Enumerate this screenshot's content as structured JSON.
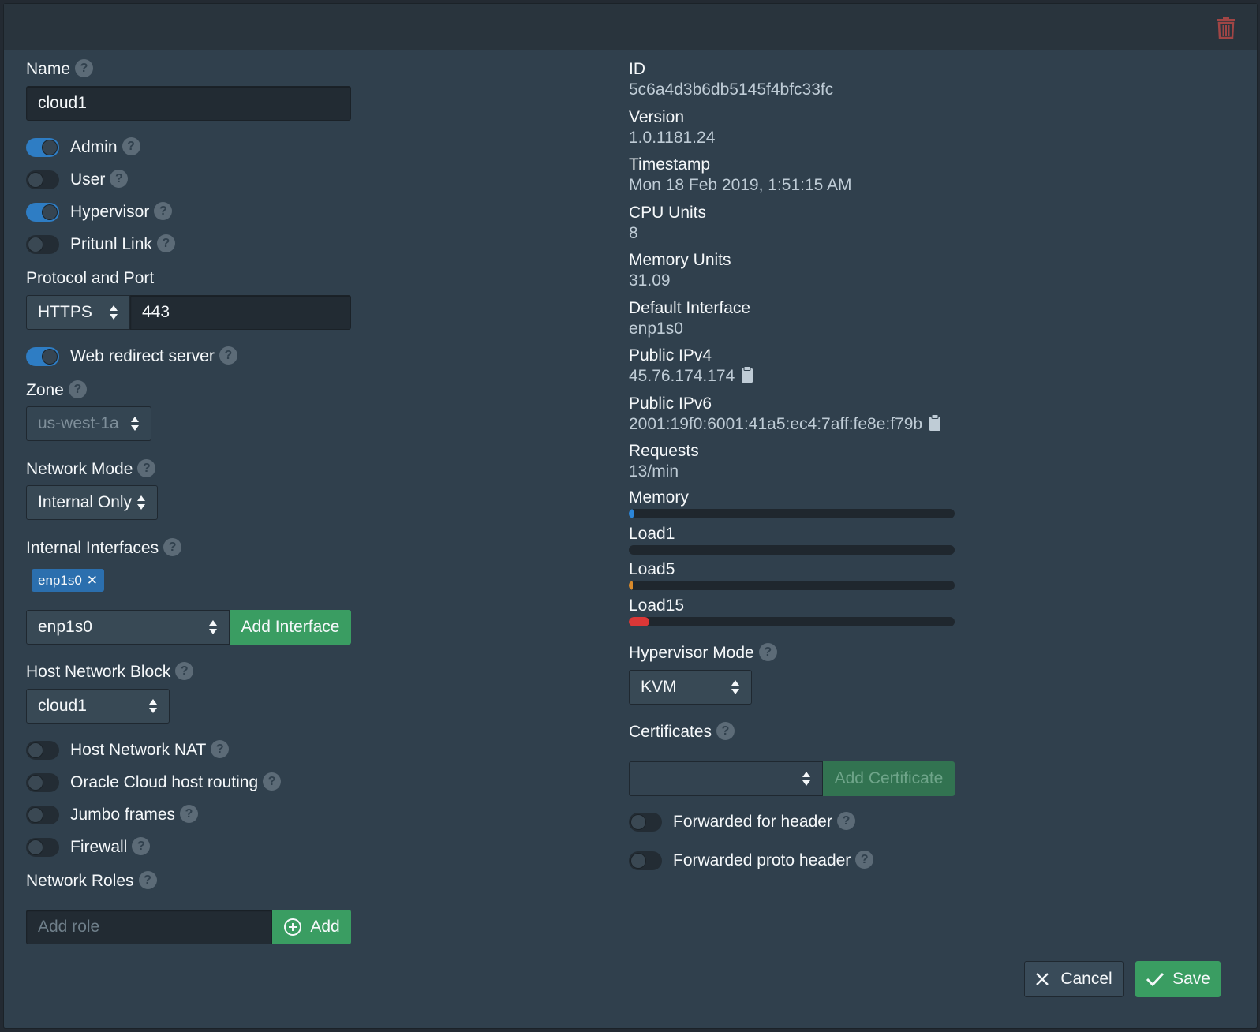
{
  "left": {
    "name_label": "Name",
    "name_value": "cloud1",
    "toggles_top": [
      {
        "label": "Admin",
        "on": true
      },
      {
        "label": "User",
        "on": false
      },
      {
        "label": "Hypervisor",
        "on": true
      },
      {
        "label": "Pritunl Link",
        "on": false
      }
    ],
    "protocol_label": "Protocol and Port",
    "protocol_value": "HTTPS",
    "port_value": "443",
    "web_redirect_label": "Web redirect server",
    "zone_label": "Zone",
    "zone_value": "us-west-1a",
    "network_mode_label": "Network Mode",
    "network_mode_value": "Internal Only",
    "internal_interfaces_label": "Internal Interfaces",
    "interface_tag": "enp1s0",
    "interface_select_value": "enp1s0",
    "add_interface_label": "Add Interface",
    "host_network_block_label": "Host Network Block",
    "host_network_block_value": "cloud1",
    "toggles_bottom": [
      {
        "label": "Host Network NAT",
        "on": false
      },
      {
        "label": "Oracle Cloud host routing",
        "on": false
      },
      {
        "label": "Jumbo frames",
        "on": false
      },
      {
        "label": "Firewall",
        "on": false
      }
    ],
    "network_roles_label": "Network Roles",
    "add_role_placeholder": "Add role",
    "add_role_button": "Add"
  },
  "right": {
    "info": [
      {
        "label": "ID",
        "value": "5c6a4d3b6db5145f4bfc33fc"
      },
      {
        "label": "Version",
        "value": "1.0.1181.24"
      },
      {
        "label": "Timestamp",
        "value": "Mon 18 Feb 2019, 1:51:15 AM"
      },
      {
        "label": "CPU Units",
        "value": "8"
      },
      {
        "label": "Memory Units",
        "value": "31.09"
      },
      {
        "label": "Default Interface",
        "value": "enp1s0"
      },
      {
        "label": "Public IPv4",
        "value": "45.76.174.174"
      },
      {
        "label": "Public IPv6",
        "value": "2001:19f0:6001:41a5:ec4:7aff:fe8e:f79b"
      },
      {
        "label": "Requests",
        "value": "13/min"
      }
    ],
    "bars": [
      {
        "label": "Memory",
        "fraction": 0.015,
        "color": "#2b86d9"
      },
      {
        "label": "Load1",
        "fraction": 0.0,
        "color": "#d99e2b"
      },
      {
        "label": "Load5",
        "fraction": 0.012,
        "color": "#d98a2b"
      },
      {
        "label": "Load15",
        "fraction": 0.062,
        "color": "#db3737"
      }
    ],
    "hypervisor_mode_label": "Hypervisor Mode",
    "hypervisor_mode_value": "KVM",
    "certificates_label": "Certificates",
    "certificate_select_value": "",
    "add_certificate_label": "Add Certificate",
    "toggles": [
      {
        "label": "Forwarded for header",
        "on": false
      },
      {
        "label": "Forwarded proto header",
        "on": false
      }
    ]
  },
  "footer": {
    "cancel_label": "Cancel",
    "save_label": "Save"
  },
  "colors": {
    "accent_blue": "#2e7dc4",
    "success_green": "#3a9d62",
    "danger_red": "#db3737"
  }
}
